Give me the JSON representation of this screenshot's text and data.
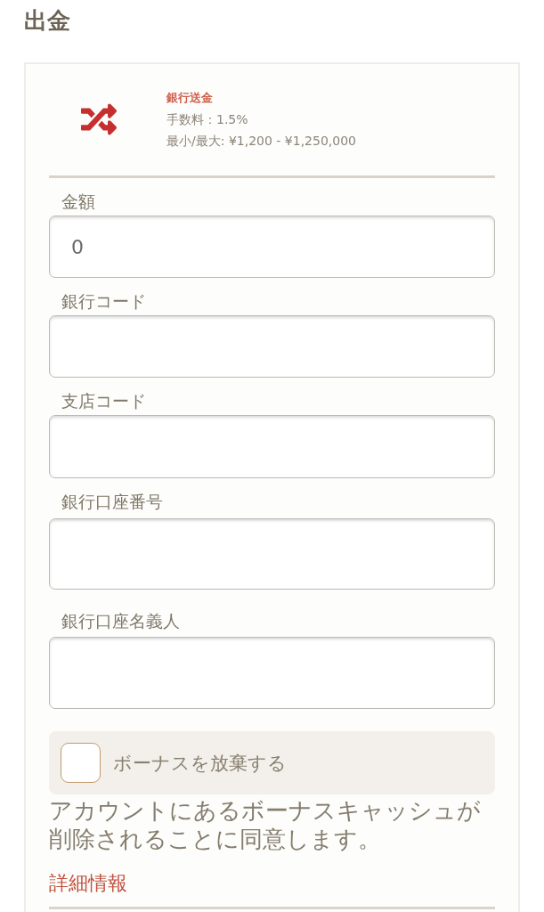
{
  "title": "出金",
  "payment_method": {
    "name": "銀行送金",
    "fee": "手数料：1.5%",
    "limits": "最小/最大: ¥1,200 - ¥1,250,000"
  },
  "fields": [
    {
      "label": "金額",
      "value": "0"
    },
    {
      "label": "銀行コード"
    },
    {
      "label": "支店コード"
    },
    {
      "label": "銀行口座番号"
    },
    {
      "label": "銀行口座名義人"
    }
  ],
  "bonus_waiver": {
    "label": "ボーナスを放棄する",
    "checked": false
  },
  "consent_text": "アカウントにあるボーナスキャッシュが削除されることに同意します。",
  "details_link": "詳細情報"
}
